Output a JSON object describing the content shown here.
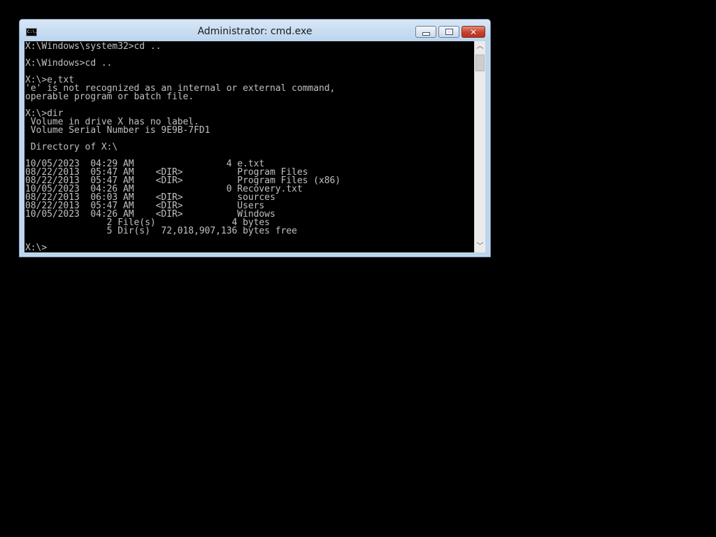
{
  "window": {
    "title": "Administrator: cmd.exe",
    "icon": "cmd-app-icon",
    "icon_text": "C:\\.",
    "minimize_icon": "minimize-icon",
    "maximize_icon": "maximize-icon",
    "close_icon": "close-icon",
    "close_glyph": "✕"
  },
  "console": {
    "text_color": "#c0c0c0",
    "background": "#000000",
    "lines": [
      "X:\\Windows\\system32>cd ..",
      "",
      "X:\\Windows>cd ..",
      "",
      "X:\\>e,txt",
      "'e' is not recognized as an internal or external command,",
      "operable program or batch file.",
      "",
      "X:\\>dir",
      " Volume in drive X has no label.",
      " Volume Serial Number is 9E9B-7FD1",
      "",
      " Directory of X:\\",
      "",
      "10/05/2023  04:29 AM                 4 e.txt",
      "08/22/2013  05:47 AM    <DIR>          Program Files",
      "08/22/2013  05:47 AM    <DIR>          Program Files (x86)",
      "10/05/2023  04:26 AM                 0 Recovery.txt",
      "08/22/2013  06:03 AM    <DIR>          sources",
      "08/22/2013  05:47 AM    <DIR>          Users",
      "10/05/2023  04:26 AM    <DIR>          Windows",
      "               2 File(s)              4 bytes",
      "               5 Dir(s)  72,018,907,136 bytes free",
      "",
      "X:\\>"
    ]
  },
  "scrollbar": {
    "up_glyph": "︿",
    "down_glyph": "﹀"
  },
  "colors": {
    "desktop": "#000000",
    "window_frame": "#bcd5ee",
    "close_button": "#c7402b"
  }
}
